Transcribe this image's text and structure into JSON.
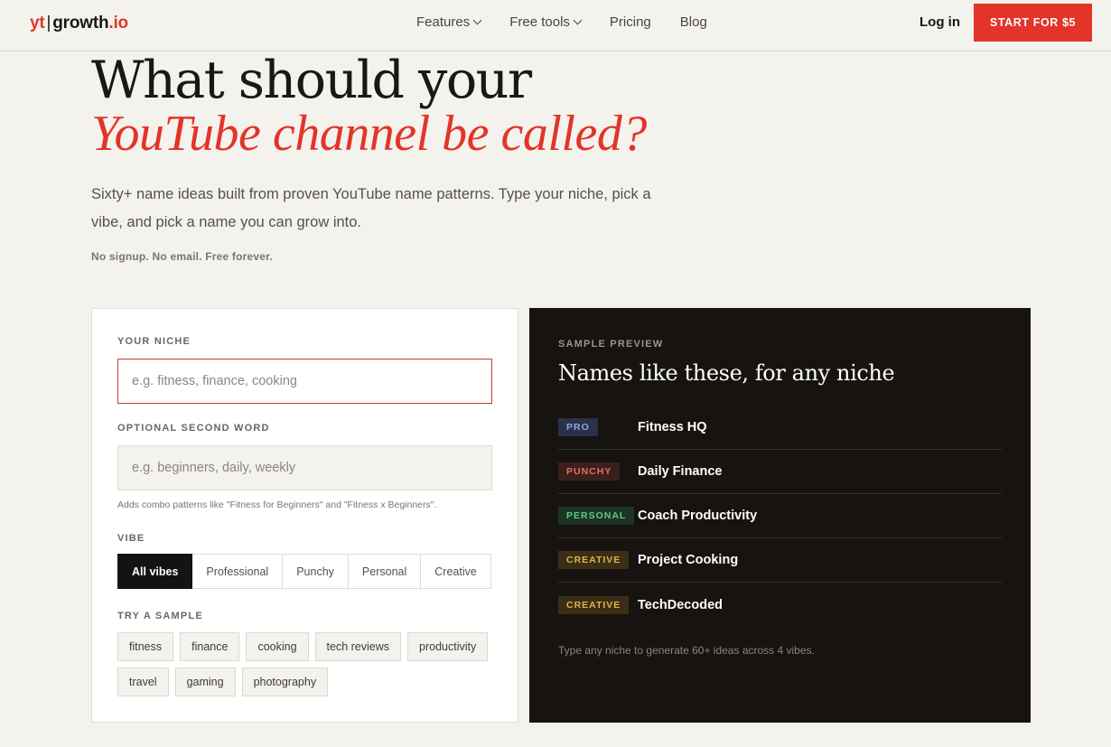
{
  "nav": {
    "logo": {
      "yt": "yt",
      "sep": "|",
      "name": "growth",
      "tld": ".io"
    },
    "links": [
      "Features",
      "Free tools",
      "Pricing",
      "Blog"
    ],
    "login": "Log in",
    "cta": "START FOR $5"
  },
  "hero": {
    "title_line1": "What should your",
    "title_line2": "YouTube channel be called?",
    "lead": "Sixty+ name ideas built from proven YouTube name patterns. Type your niche, pick a vibe, and pick a name you can grow into.",
    "fine": "No signup. No email. Free forever."
  },
  "form": {
    "niche_label": "YOUR NICHE",
    "niche_placeholder": "e.g. fitness, finance, cooking",
    "niche_value": "",
    "second_label": "OPTIONAL SECOND WORD",
    "second_placeholder": "e.g. beginners, daily, weekly",
    "second_value": "",
    "second_hint": "Adds combo patterns like \"Fitness for Beginners\" and \"Fitness x Beginners\".",
    "vibe_label": "VIBE",
    "vibes": [
      "All vibes",
      "Professional",
      "Punchy",
      "Personal",
      "Creative"
    ],
    "vibe_selected": "All vibes",
    "sample_label": "TRY A SAMPLE",
    "samples": [
      "fitness",
      "finance",
      "cooking",
      "tech reviews",
      "productivity",
      "travel",
      "gaming",
      "photography"
    ]
  },
  "preview": {
    "label": "SAMPLE PREVIEW",
    "title": "Names like these, for any niche",
    "rows": [
      {
        "tag": "PRO",
        "name": "Fitness HQ"
      },
      {
        "tag": "PUNCHY",
        "name": "Daily Finance"
      },
      {
        "tag": "PERSONAL",
        "name": "Coach Productivity"
      },
      {
        "tag": "CREATIVE",
        "name": "Project Cooking"
      },
      {
        "tag": "CREATIVE",
        "name": "TechDecoded"
      }
    ],
    "footer": "Type any niche to generate 60+ ideas across 4 vibes."
  },
  "colors": {
    "accent": "#e3342a",
    "background": "#f4f2ec",
    "panel": "#161310"
  }
}
